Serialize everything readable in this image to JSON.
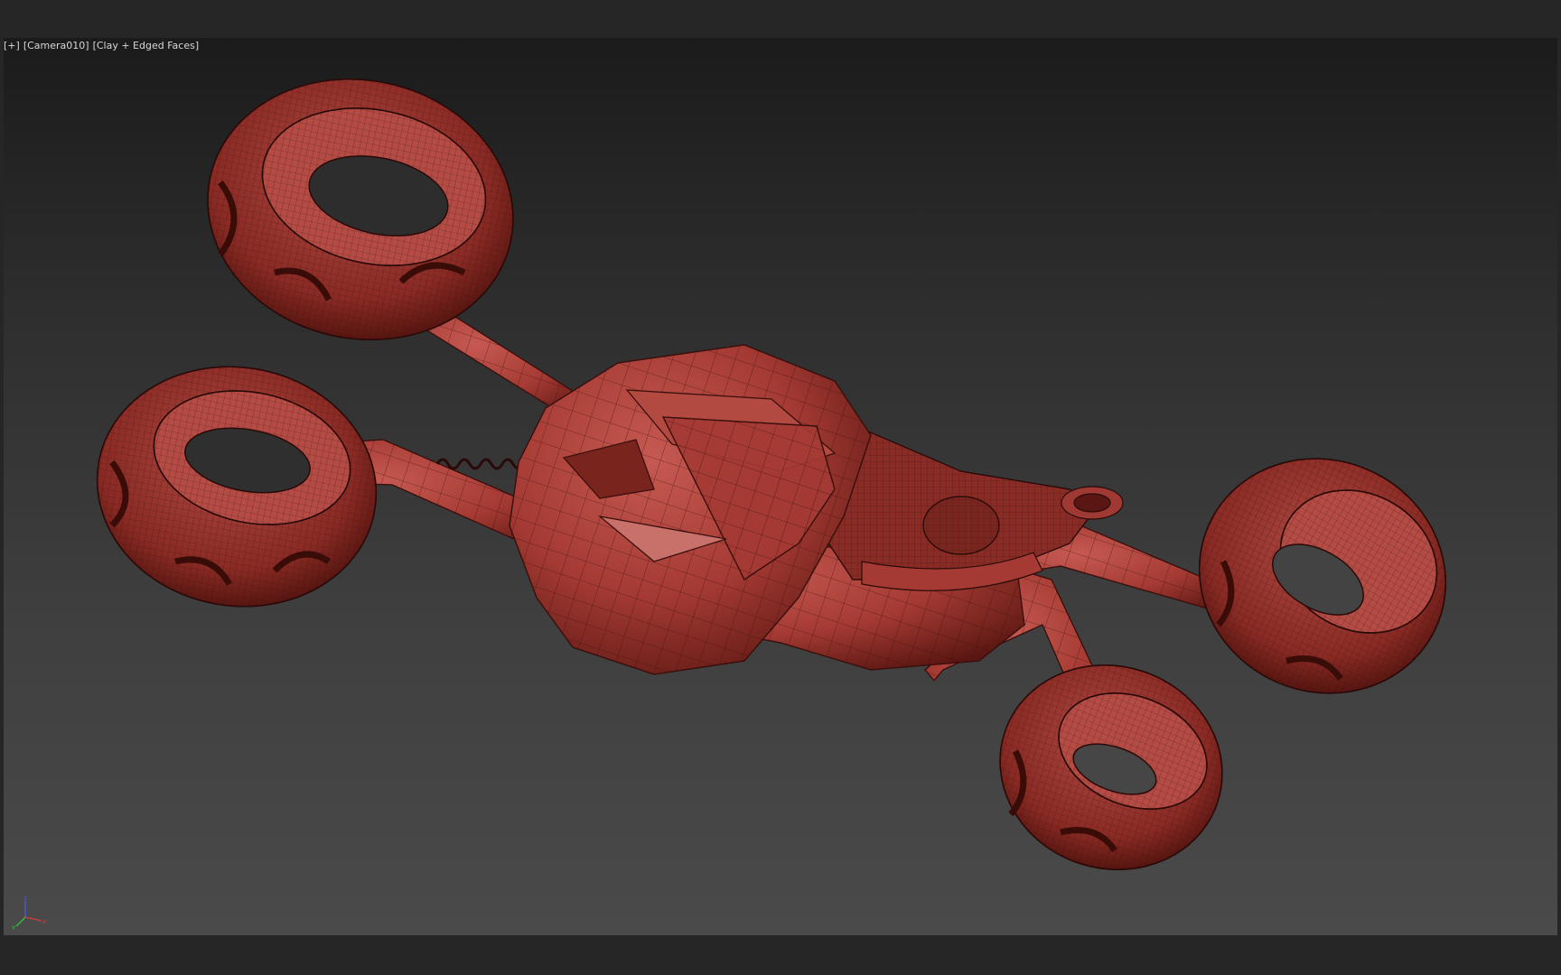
{
  "viewport": {
    "label_plus": "[+]",
    "label_camera": "[Camera010]",
    "label_shading": "[Clay + Edged Faces]"
  },
  "model": {
    "description_icon": "hover-bike-wireframe",
    "clay_color": "#a8403a",
    "edge_color": "#3a0f0c"
  },
  "axis_gizmo": {
    "x_label": "x",
    "y_label": "y",
    "z_label": "z",
    "x_color": "#d23a3a",
    "y_color": "#3ab83a",
    "z_color": "#4a5ad8"
  }
}
